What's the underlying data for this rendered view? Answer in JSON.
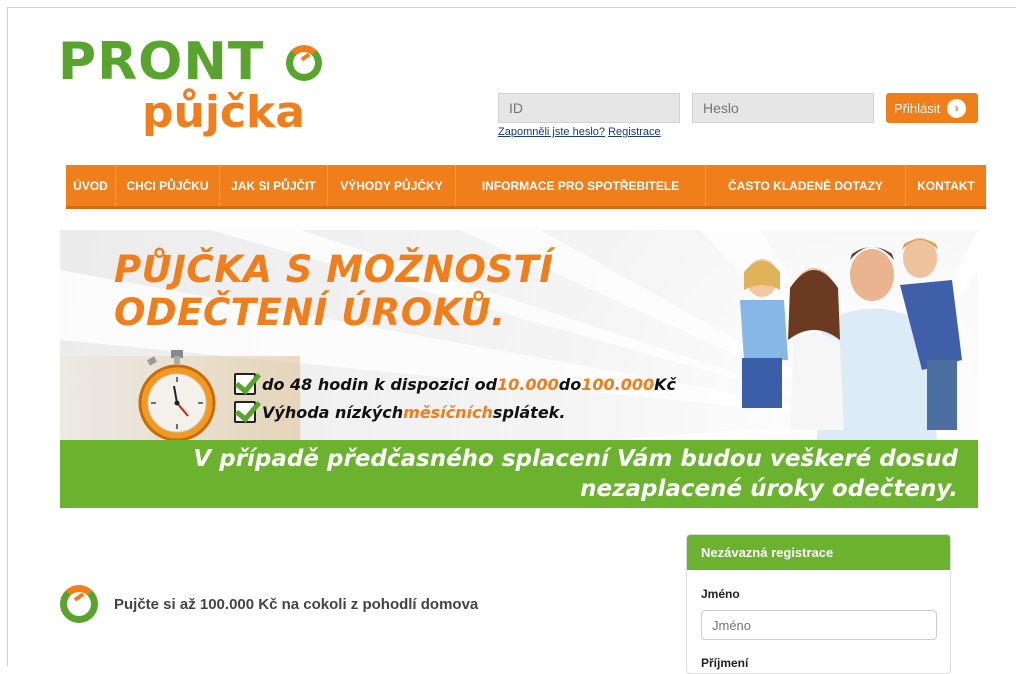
{
  "logo": {
    "line1": "PRONT",
    "line2": "půjčka"
  },
  "login": {
    "id_placeholder": "ID",
    "password_placeholder": "Heslo",
    "submit_label": "Přihlásit",
    "forgot_label": "Zapomněli jste heslo?",
    "register_label": "Registrace"
  },
  "nav": {
    "items": [
      {
        "label": "ÚVOD"
      },
      {
        "label": "CHCI PŮJČKU"
      },
      {
        "label": "JAK SI PŮJČIT"
      },
      {
        "label": "VÝHODY PŮJČKY"
      },
      {
        "label": "INFORMACE PRO SPOTŘEBITELE"
      },
      {
        "label": "ČASTO KLADENÉ DOTAZY"
      },
      {
        "label": "KONTAKT"
      }
    ]
  },
  "banner": {
    "headline_line1": "PŮJČKA S MOŽNOSTÍ",
    "headline_line2": "ODEČTENÍ ÚROKŮ.",
    "bullet1": {
      "pre": "do 48 hodin k dispozici od ",
      "from": "10.000",
      "mid": " do ",
      "to": "100.000",
      "post": " Kč"
    },
    "bullet2": {
      "pre": "Výhoda nízkých ",
      "highlight": "měsíčních",
      "post": " splátek."
    },
    "green_line1": "V případě předčasného splacení Vám budou veškeré dosud",
    "green_line2": "nezaplacené úroky odečteny."
  },
  "promo": {
    "text": "Pujčte si až 100.000 Kč na cokoli z pohodlí domova"
  },
  "registration": {
    "title": "Nezávazná registrace",
    "first_name_label": "Jméno",
    "first_name_placeholder": "Jméno",
    "last_name_label": "Příjmení"
  },
  "colors": {
    "orange": "#f07e1a",
    "green": "#6bb22e",
    "logo_green": "#58a42d"
  }
}
